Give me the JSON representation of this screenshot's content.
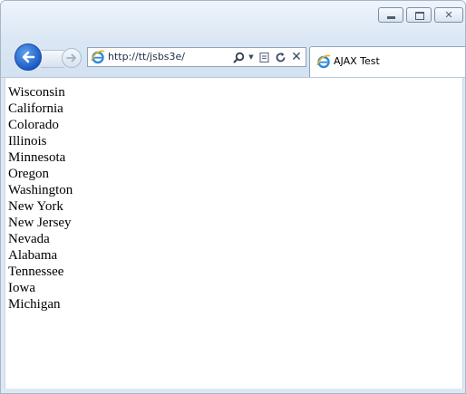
{
  "browser": {
    "address": "http://tt/jsbs3e/",
    "tab_title": "AJAX Test",
    "icons": {
      "back": "back-arrow-icon",
      "forward": "forward-arrow-icon",
      "page": "internet-explorer-icon",
      "search": "search-icon",
      "dropdown": "dropdown-arrow-icon",
      "compat": "compatibility-view-icon",
      "refresh": "refresh-icon",
      "stop": "stop-icon",
      "minimize": "minimize-icon",
      "maximize": "maximize-icon",
      "close": "close-icon"
    },
    "accent_color": "#1c5cc8"
  },
  "states": [
    "Wisconsin",
    "California",
    "Colorado",
    "Illinois",
    "Minnesota",
    "Oregon",
    "Washington",
    "New York",
    "New Jersey",
    "Nevada",
    "Alabama",
    "Tennessee",
    "Iowa",
    "Michigan"
  ]
}
